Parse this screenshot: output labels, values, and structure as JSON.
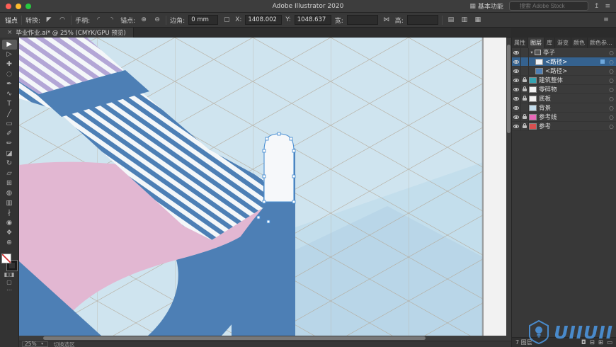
{
  "titlebar": {
    "title": "Adobe Illustrator 2020",
    "workspace_label": "基本功能",
    "workspace_icon": "▦",
    "search_placeholder": "搜索 Adobe Stock",
    "share_icon": "↥",
    "menu_icon": "≡"
  },
  "controlbar": {
    "context_label": "锚点",
    "convert_label": "转换:",
    "convert_icon_1": "◤",
    "convert_icon_2": "◠",
    "handles_label": "手柄:",
    "handle_icon_1": "◜",
    "handle_icon_2": "◝",
    "anchors_label": "锚点:",
    "anchor_add_icon": "⊕",
    "anchor_remove_icon": "⊖",
    "corner_label": "边角:",
    "corner_value": "0 mm",
    "ref_point_icon": "▢",
    "x_label": "X:",
    "x_value": "1408.002",
    "y_label": "Y:",
    "y_value": "1048.637",
    "w_label": "宽:",
    "w_value": "",
    "link_icon": "⋈",
    "h_label": "高:",
    "h_value": "",
    "align_icon_1": "▤",
    "align_icon_2": "▥",
    "align_icon_3": "▦",
    "panel_menu_icon": "≡"
  },
  "doc_tab": {
    "title": "毕业作业.ai* @ 25% (CMYK/GPU 预览)",
    "close_icon": "×"
  },
  "tools": [
    {
      "name": "selection-tool",
      "glyph": "▶"
    },
    {
      "name": "direct-selection-tool",
      "glyph": "▷"
    },
    {
      "name": "magic-wand-tool",
      "glyph": "✚"
    },
    {
      "name": "lasso-tool",
      "glyph": "◌"
    },
    {
      "name": "pen-tool",
      "glyph": "✒"
    },
    {
      "name": "curvature-tool",
      "glyph": "∿"
    },
    {
      "name": "type-tool",
      "glyph": "T"
    },
    {
      "name": "line-segment-tool",
      "glyph": "╱"
    },
    {
      "name": "rectangle-tool",
      "glyph": "▭"
    },
    {
      "name": "paintbrush-tool",
      "glyph": "✐"
    },
    {
      "name": "pencil-tool",
      "glyph": "✏"
    },
    {
      "name": "eraser-tool",
      "glyph": "◪"
    },
    {
      "name": "rotate-tool",
      "glyph": "↻"
    },
    {
      "name": "scale-tool",
      "glyph": "▱"
    },
    {
      "name": "free-transform-tool",
      "glyph": "⊞"
    },
    {
      "name": "shape-builder-tool",
      "glyph": "◍"
    },
    {
      "name": "gradient-tool",
      "glyph": "▥"
    },
    {
      "name": "eyedropper-tool",
      "glyph": "∤"
    },
    {
      "name": "blend-tool",
      "glyph": "◉"
    },
    {
      "name": "hand-tool",
      "glyph": "❖"
    },
    {
      "name": "zoom-tool",
      "glyph": "⊕"
    }
  ],
  "canvas": {
    "palette": {
      "background": "#cfe4ef",
      "floor_light": "#c3deec",
      "floor_mid": "#b9d6e8",
      "grid": "#b4a897",
      "blue": "#4d7fb5",
      "pink": "#e2b7d2",
      "purple": "#b3a6d6",
      "white": "#f4f7f9",
      "door": "#f6f8fa",
      "selection": "#4a8fd3"
    }
  },
  "statusbar": {
    "zoom": "25%",
    "zoom_caret": "▾",
    "hint": "切换选区"
  },
  "panel": {
    "tabs": [
      "属性",
      "图层",
      "库",
      "渐变",
      "颜色",
      "颜色参..."
    ],
    "menu_icon": "≡",
    "layers": {
      "items": [
        {
          "caret": "▾",
          "label": "亭子",
          "target": "○"
        },
        {
          "label": "<路径>",
          "target": "○",
          "thumb": "#eef2f6",
          "chip": "#6fa8dc"
        },
        {
          "label": "<路径>",
          "target": "○",
          "thumb": "#4d7fb5"
        },
        {
          "label": "建筑整体",
          "target": "○",
          "thumb": "#35a3b0"
        },
        {
          "label": "零碎物",
          "target": "○",
          "thumb": "#f2f2f2"
        },
        {
          "label": "底板",
          "target": "○",
          "thumb": "#f2f2f2"
        },
        {
          "label": "背景",
          "target": "○",
          "thumb": "#c2dcec"
        },
        {
          "label": "参考线",
          "target": "○",
          "thumb": "#e868b8"
        },
        {
          "label": "参考",
          "target": "○",
          "thumb": "#d85050"
        }
      ]
    },
    "footer": {
      "count": "7 图层",
      "mask_icon": "◘",
      "sublayer_icon": "⊟",
      "new_layer_icon": "⊞",
      "delete_icon": "▭"
    }
  },
  "watermark": {
    "text": "UIIUII"
  }
}
